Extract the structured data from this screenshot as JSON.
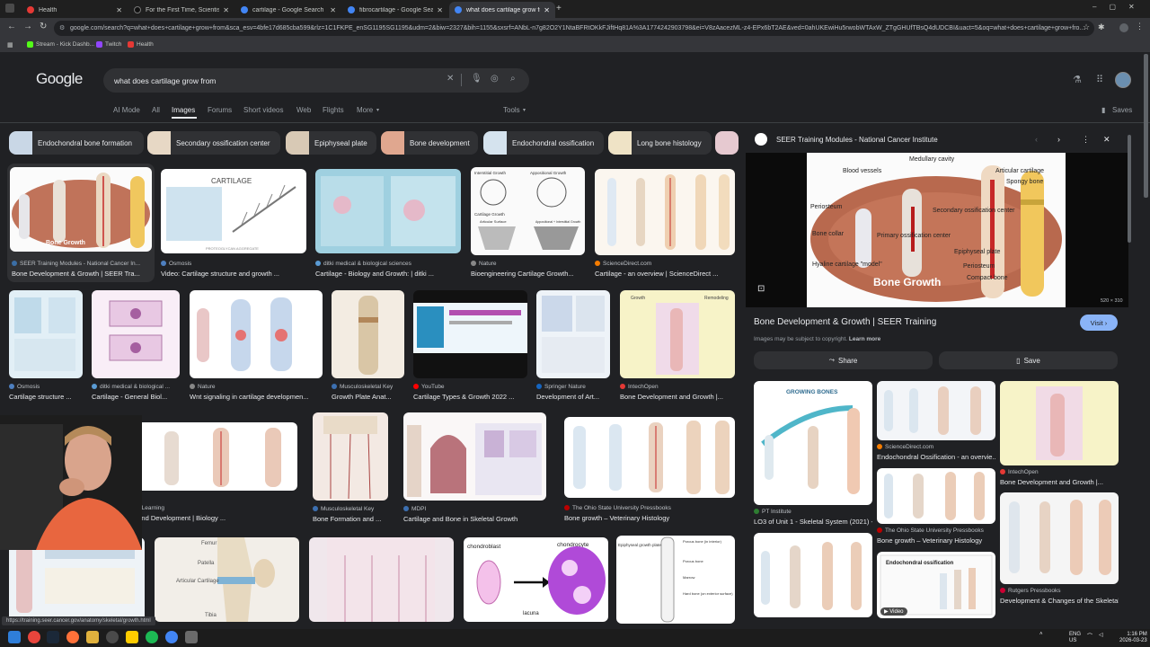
{
  "browser": {
    "tabs": [
      {
        "title": "Health",
        "color": "#e53935"
      },
      {
        "title": "For the First Time, Scientists M...",
        "color": "#111111"
      },
      {
        "title": "cartilage - Google Search",
        "color": "#4285f4"
      },
      {
        "title": "fibrocartilage - Google Search",
        "color": "#4285f4"
      },
      {
        "title": "what does cartilage grow from",
        "color": "#4285f4"
      }
    ],
    "new_tab": "+",
    "url": "google.com/search?q=what+does+cartilage+grow+from&sca_esv=4bfe17d685cba599&rlz=1C1FKPE_enSG1195SG1195&udm=2&biw=2327&bih=1155&sxsrf=ANbL-n7g82O2Y1NtaBFRtOKkFJiftHq81A%3A1774242903798&ei=V8zAacezML-z4-EPx6bT2AE&ved=0ahUKEwiHu5rwobWTAxW_ZTgGHUfTBsQ4dUDCBI&uact=5&oq=what+does+cartilage+grow+fro...",
    "bookmarks": [
      {
        "label": "Stream - Kick Dashb...",
        "color": "#53fc18"
      },
      {
        "label": "Twitch",
        "color": "#9146ff"
      },
      {
        "label": "Health",
        "color": "#e53935"
      }
    ]
  },
  "google": {
    "logo": "Google",
    "query": "what does cartilage grow from",
    "filters": [
      "AI Mode",
      "All",
      "Images",
      "Forums",
      "Short videos",
      "Web",
      "Flights",
      "More",
      "Tools"
    ],
    "saves_label": "Saves"
  },
  "chips": [
    "Endochondral bone formation",
    "Secondary ossification center",
    "Epiphyseal plate",
    "Bone development",
    "Endochondral ossification",
    "Long bone histology"
  ],
  "results": [
    {
      "source": "SEER Training Modules - National Cancer In...",
      "caption": "Bone Development & Growth | SEER Tra...",
      "color": "#c98462"
    },
    {
      "source": "Osmosis",
      "caption": "Video: Cartilage structure and growth ...",
      "color": "#e9f2f7"
    },
    {
      "source": "ditki medical & biological sciences",
      "caption": "Cartilage - Biology and Growth: | ditki ...",
      "color": "#a9d3e3"
    },
    {
      "source": "Nature",
      "caption": "Bioengineering Cartilage Growth...",
      "color": "#f4f4f4"
    },
    {
      "source": "ScienceDirect.com",
      "caption": "Cartilage - an overview | ScienceDirect ...",
      "color": "#f6efe6"
    },
    {
      "source": "Osmosis",
      "caption": "Cartilage structure ...",
      "color": "#dfeef4"
    },
    {
      "source": "ditki medical & biological ...",
      "caption": "Cartilage - General Biol...",
      "color": "#f3e4f1"
    },
    {
      "source": "Nature",
      "caption": "Wnt signaling in cartilage developmen...",
      "color": "#f5eef0"
    },
    {
      "source": "Musculoskeletal Key",
      "caption": "Growth Plate Anat...",
      "color": "#ece3d4"
    },
    {
      "source": "YouTube",
      "caption": "Cartilage Types & Growth 2022 ...",
      "color": "#111111"
    },
    {
      "source": "Springer Nature",
      "caption": "Development of Art...",
      "color": "#eef3f8"
    },
    {
      "source": "IntechOpen",
      "caption": "Bone Development and Growth |...",
      "color": "#f2e6e0"
    },
    {
      "source": "Lumen Learning",
      "caption": "Growth and Development | Biology ...",
      "color": "#f6f6f6"
    },
    {
      "source": "Musculoskeletal Key",
      "caption": "Bone Formation and ...",
      "color": "#f0e6df"
    },
    {
      "source": "MDPI",
      "caption": "Cartilage and Bone in Skeletal Growth",
      "color": "#eadfe6"
    },
    {
      "source": "The Ohio State University Pressbooks",
      "caption": "Bone growth – Veterinary Histology",
      "color": "#f4f4f4"
    },
    {
      "source": "",
      "caption": "",
      "color": "#eef3f7"
    },
    {
      "source": "",
      "caption": "",
      "color": "#f2eee8"
    },
    {
      "source": "",
      "caption": "",
      "color": "#f0e7ec"
    },
    {
      "source": "",
      "caption": "",
      "color": "#ffffff"
    },
    {
      "source": "",
      "caption": "",
      "color": "#ffffff"
    }
  ],
  "panel": {
    "source": "SEER Training Modules - National Cancer Institute",
    "title": "Bone Development & Growth | SEER Training",
    "visit_label": "Visit",
    "copyright": "Images may be subject to copyright.",
    "learn_more": "Learn more",
    "share_label": "Share",
    "save_label": "Save",
    "dims": "520 × 310",
    "diagram_labels": {
      "cavity": "Medullary cavity",
      "vessels": "Blood vessels",
      "articular": "Articular cartilage",
      "spongy": "Spongy bone",
      "periosteum1": "Periosteum",
      "secondary": "Secondary ossification center",
      "collar": "Bone collar",
      "primary": "Primary ossification center",
      "epiphyseal": "Epiphyseal plate",
      "hyaline": "Hyaline cartilage \"model\"",
      "periosteum2": "Periosteum",
      "compact": "Compact bone",
      "banner": "Bone Growth"
    },
    "related": [
      {
        "source": "PT Institute",
        "caption": "LO3 of Unit 1 - Skeletal System (2021) -...",
        "label": "GROWING BONES"
      },
      {
        "source": "ScienceDirect.com",
        "caption": "Endochondral Ossification - an overvie...",
        "label": ""
      },
      {
        "source": "IntechOpen",
        "caption": "Bone Development and Growth |...",
        "label": ""
      },
      {
        "source": "The Ohio State University Pressbooks",
        "caption": "Bone growth – Veterinary Histology",
        "label": ""
      },
      {
        "source": "Rutgers Pressbooks",
        "caption": "Development & Changes of the Skeletal...",
        "label": ""
      },
      {
        "source": "",
        "caption": "",
        "label": "Endochondral ossification",
        "badge": "Video"
      }
    ]
  },
  "thumb_labels": {
    "cartilage_word": "CARTILAGE",
    "fibro": "PROTEOGLYCAN AGGREGATE",
    "bone_growth": "Bone Growth",
    "interstitial": "Interstitial Growth",
    "appositional": "Appositional Growth",
    "cartilage_growth": "Cartilage Growth",
    "articular_surface": "Articular Surface",
    "appos_inter": "Appositional + Interstitial Growth",
    "growth": "Growth",
    "remodeling": "Remodeling",
    "femur": "Femur",
    "patella": "Patella",
    "articular_cart": "Articular Cartilage",
    "tibia": "Tibia",
    "chondroblast": "chondroblast",
    "chondrocyte": "chondrocyte",
    "lacuna": "lacuna",
    "epiphyseal_plate": "Epiphyseal growth plate",
    "porous_interior": "Porous bone (in interior)",
    "porous_exterior": "Porous bone",
    "marrow": "Marrow",
    "hard_bone": "Hard bone (on exterior surface)"
  },
  "status_url": "https://training.seer.cancer.gov/anatomy/skeletal/growth.html",
  "tray": {
    "lang1": "ENG",
    "lang2": "US",
    "time": "1:16 PM",
    "date": "2026-03-23"
  }
}
